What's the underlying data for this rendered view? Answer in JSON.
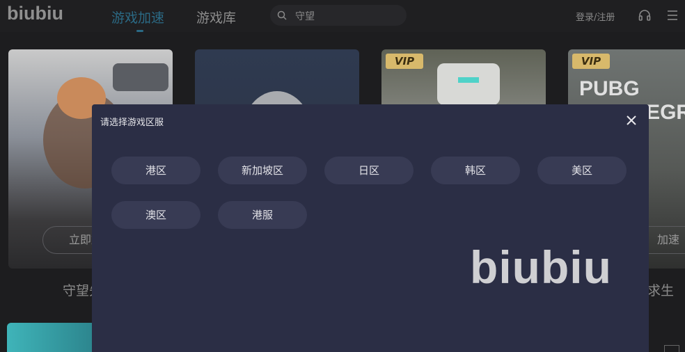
{
  "app": {
    "logo": "biubiu"
  },
  "nav": {
    "tabs": [
      {
        "label": "游戏加速",
        "active": true
      },
      {
        "label": "游戏库",
        "active": false
      }
    ]
  },
  "search": {
    "value": "守望"
  },
  "header": {
    "login_label": "登录/注册"
  },
  "games": [
    {
      "button": "立即加速",
      "title": "守望先锋",
      "vip": false
    },
    {
      "button": "",
      "title": "",
      "vip": false
    },
    {
      "button": "",
      "title": "",
      "vip": true,
      "badge": "VIP"
    },
    {
      "button": "加速",
      "title": "求生",
      "vip": true,
      "badge": "VIP",
      "art_text": "PUBG BATTLEGROU"
    }
  ],
  "modal": {
    "title": "请选择游戏区服",
    "regions": [
      "港区",
      "新加坡区",
      "日区",
      "韩区",
      "美区",
      "澳区",
      "港服"
    ],
    "brand": "biubiu"
  },
  "colors": {
    "accent": "#2b6a85",
    "modal_bg": "#2b2e45",
    "region_btn_bg": "#383b54"
  }
}
